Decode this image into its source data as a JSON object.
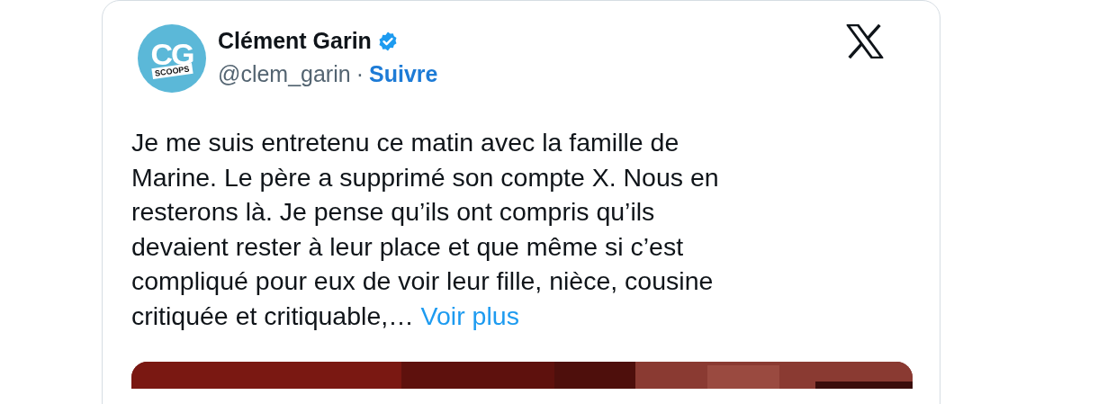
{
  "author": {
    "avatar_text": "CG",
    "avatar_subtext": "SCOOPS",
    "name": "Clément Garin",
    "verified": true,
    "handle": "@clem_garin",
    "separator": "·",
    "follow": "Suivre"
  },
  "body": {
    "lines": [
      "Je me suis entretenu ce matin avec la famille de",
      "Marine. Le père a supprimé son compte X. Nous en",
      "resterons là. Je pense qu’ils ont compris qu’ils",
      "devaient rester à leur place et que même si c’est",
      "compliqué pour eux de voir leur fille, nièce, cousine",
      "critiquée et critiquable,…"
    ],
    "more": "Voir plus"
  }
}
